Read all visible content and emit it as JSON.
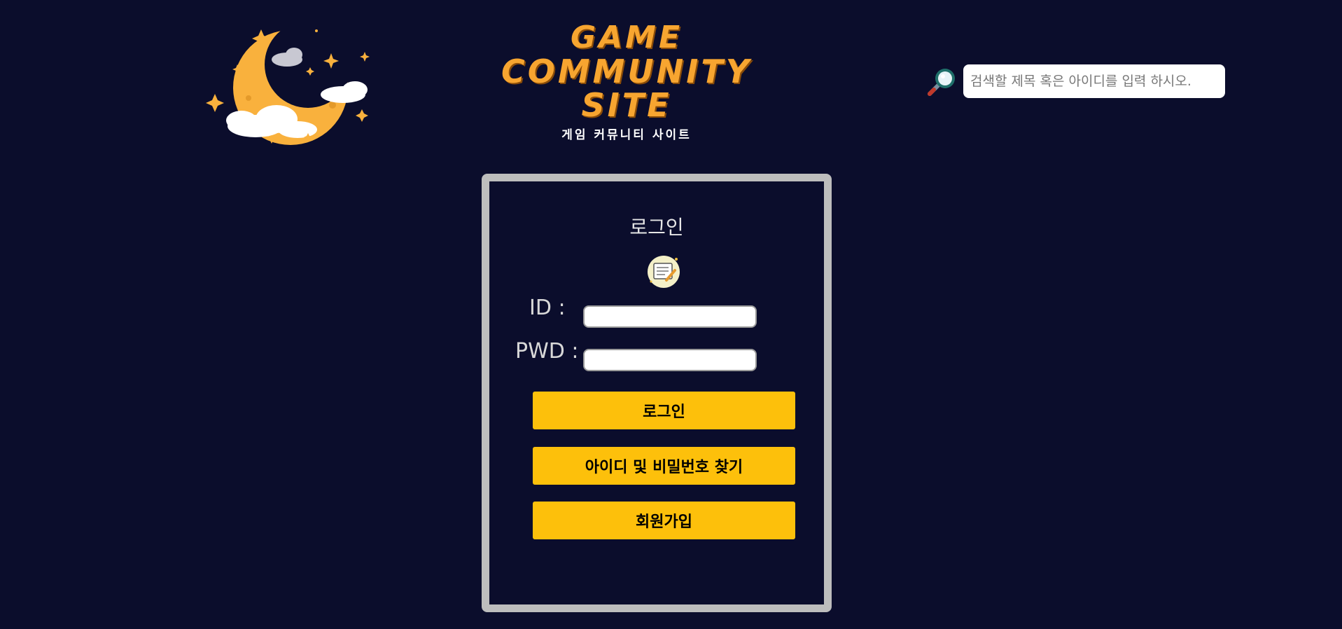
{
  "header": {
    "logo_title_lines": [
      "GAME",
      "COMMUNITY",
      "SITE"
    ],
    "logo_subtitle": "게임 커뮤니티 사이트",
    "moon_logo_icon": "crescent-moon-clouds-stars-icon",
    "search": {
      "icon": "magnifier-icon",
      "placeholder": "검색할 제목 혹은 아이디를 입력 하시오.",
      "value": ""
    }
  },
  "login": {
    "title": "로그인",
    "icon": "memo-pencil-icon",
    "id_label": "ID :",
    "id_value": "",
    "pwd_label": "PWD :",
    "pwd_value": "",
    "buttons": {
      "login": "로그인",
      "find_account": "아이디 및 비밀번호 찾기",
      "signup": "회원가입"
    }
  },
  "colors": {
    "background": "#0b0d2c",
    "accent_button": "#fdc00b",
    "logo_orange": "#f7a530",
    "panel_border": "#bdbdbd"
  }
}
